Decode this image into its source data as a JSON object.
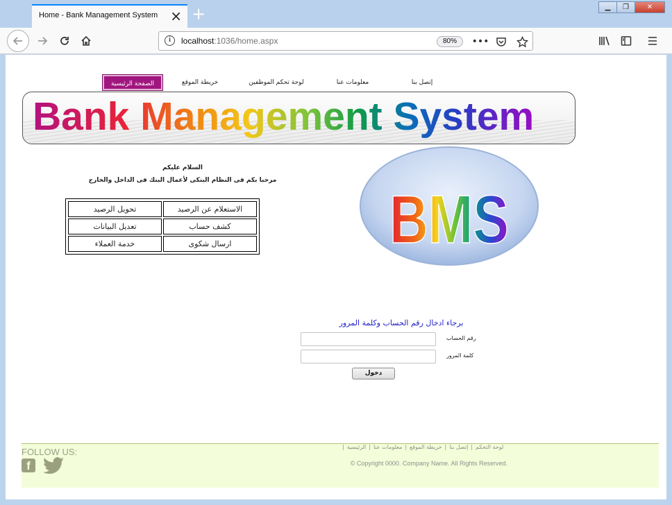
{
  "browser": {
    "tab_title": "Home - Bank Management System",
    "url_host": "localhost",
    "url_rest": ":1036/home.aspx",
    "zoom": "80%"
  },
  "site_nav": {
    "items": [
      {
        "label": "الصفحة الرئيسية",
        "active": true
      },
      {
        "label": "خريطة الموقع",
        "active": false
      },
      {
        "label": "لوحة تحكم الموظفين",
        "active": false
      },
      {
        "label": "معلومات عنا",
        "active": false
      },
      {
        "label": "إتصل بنا",
        "active": false
      }
    ]
  },
  "banner": {
    "title": "Bank Management System"
  },
  "logo": {
    "text": "BMS"
  },
  "welcome": {
    "line1": "السلام عليكم",
    "line2": "مرحبا بكم فى النظام البنكى لأعمال البنك فى الداخل والخارج"
  },
  "services": {
    "rows": [
      [
        "الاستعلام عن الرصيد",
        "تحويل الرصيد"
      ],
      [
        "كشف حساب",
        "تعديل البيانات"
      ],
      [
        "ارسال شكوى",
        "خدمة العملاء"
      ]
    ]
  },
  "login": {
    "prompt": "برجاء ادخال رقم الحساب وكلمة المرور",
    "account_label": "رقم الحساب",
    "password_label": "كلمة المرور",
    "account_value": "",
    "password_value": "",
    "submit_label": "دخول"
  },
  "footer": {
    "follow": "FOLLOW US:",
    "links": [
      "لوحة التحكم",
      "إتصل بنا",
      "خريطة الموقع",
      "معلومات عنا",
      "الرئيسية"
    ],
    "copyright": "© Copyright 0000. Company Name. All Rights Reserved."
  },
  "colors": {
    "nav_active": "#a0167f",
    "footer_bg": "#f4fdd9",
    "prompt": "#1e1ec8"
  }
}
